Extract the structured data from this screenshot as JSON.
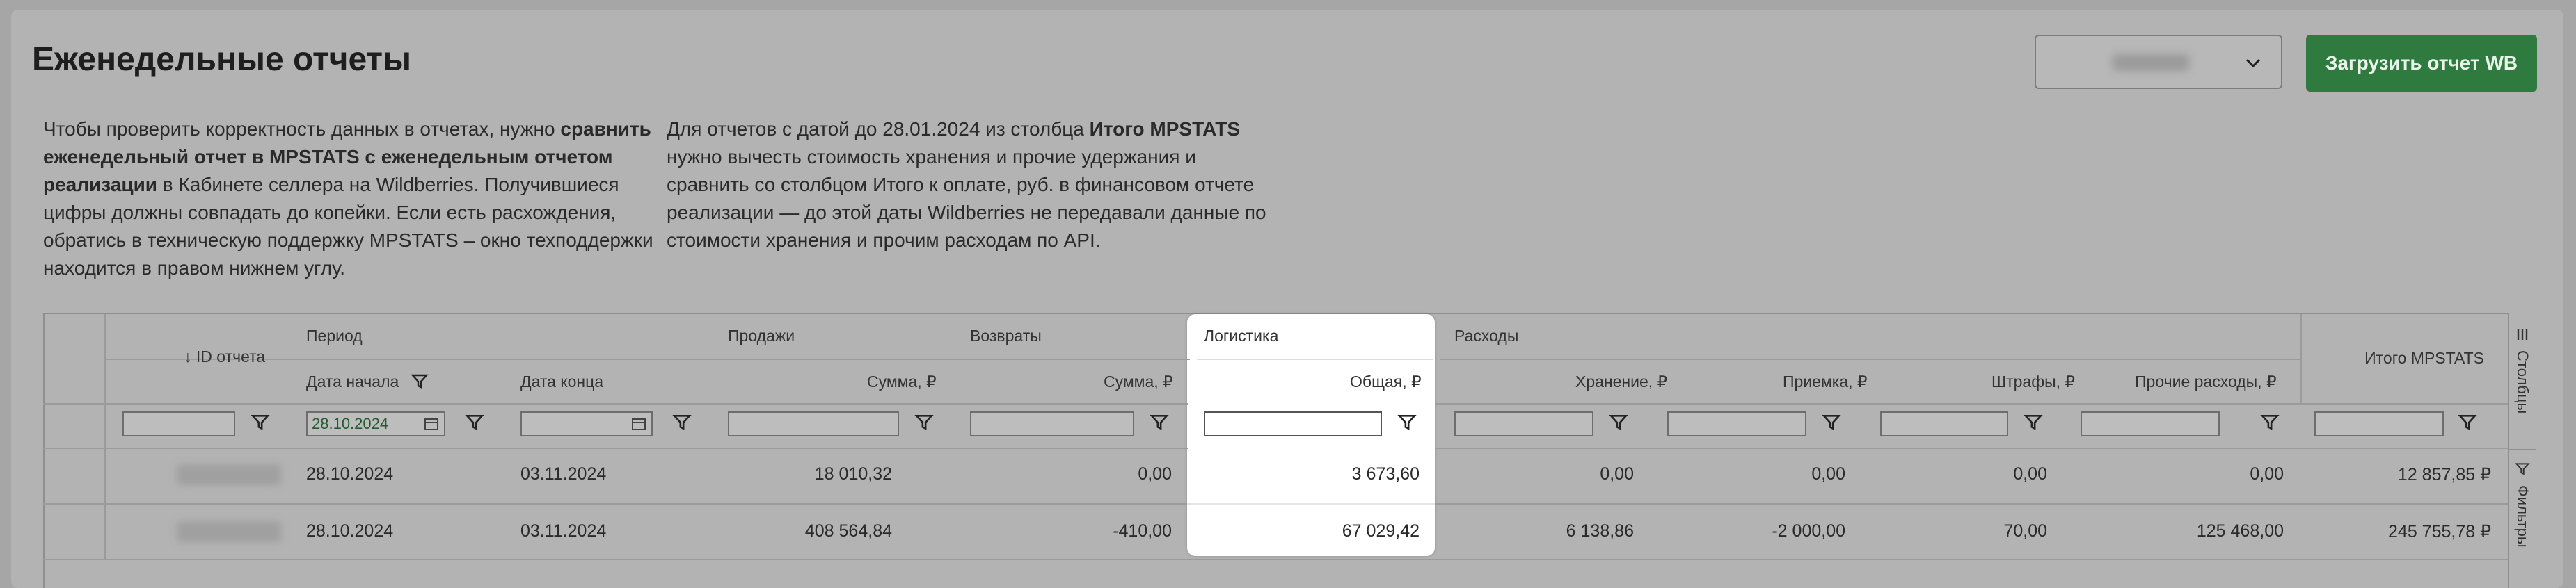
{
  "header": {
    "title": "Еженедельные отчеты",
    "upload_button": "Загрузить отчет WB"
  },
  "info": {
    "left": [
      {
        "text": "Чтобы проверить корректность данных в отчетах, нужно ",
        "bold": false
      },
      {
        "text": "сравнить еженедельный отчет в MPSTATS с еженедельным отчетом реализации",
        "bold": true
      },
      {
        "text": " в Кабинете селлера на Wildberries. Получившиеся цифры должны совпадать до копейки. Если есть расхождения, обратись в техническую поддержку MPSTATS – окно техподдержки находится в правом нижнем углу.",
        "bold": false
      }
    ],
    "right": [
      {
        "text": "Для отчетов с датой до 28.01.2024 из столбца ",
        "bold": false
      },
      {
        "text": "Итого MPSTATS",
        "bold": true
      },
      {
        "text": " нужно вычесть стоимость хранения и прочие удержания и сравнить со столбцом Итого к оплате, руб. в финансовом отчете реализации — до этой даты Wildberries не передавали данные по стоимости хранения и прочим расходам по API.",
        "bold": false
      }
    ]
  },
  "table": {
    "col_id": "↓ ID отчета",
    "groups": {
      "period": "Период",
      "sales": "Продажи",
      "returns": "Возвраты",
      "logistics": "Логистика",
      "expenses": "Расходы",
      "total": "Итого MPSTATS"
    },
    "cols": {
      "date_start": "Дата начала",
      "date_end": "Дата конца",
      "sales_sum": "Сумма, ₽",
      "returns_sum": "Сумма, ₽",
      "logistics_total": "Общая, ₽",
      "storage": "Хранение, ₽",
      "acceptance": "Приемка, ₽",
      "fines": "Штрафы, ₽",
      "other": "Прочие расходы, ₽"
    },
    "filter_date_start": "28.10.2024",
    "rows": [
      {
        "date_start": "28.10.2024",
        "date_end": "03.11.2024",
        "sales": "18 010,32",
        "returns": "0,00",
        "logistics": "3 673,60",
        "storage": "0,00",
        "acceptance": "0,00",
        "fines": "0,00",
        "other": "0,00",
        "total": "12 857,85 ₽"
      },
      {
        "date_start": "28.10.2024",
        "date_end": "03.11.2024",
        "sales": "408 564,84",
        "returns": "-410,00",
        "logistics": "67 029,42",
        "storage": "6 138,86",
        "acceptance": "-2 000,00",
        "fines": "70,00",
        "other": "125 468,00",
        "total": "245 755,78 ₽"
      }
    ]
  },
  "side_panel": {
    "columns": "Столбцы",
    "filters": "Фильтры"
  }
}
